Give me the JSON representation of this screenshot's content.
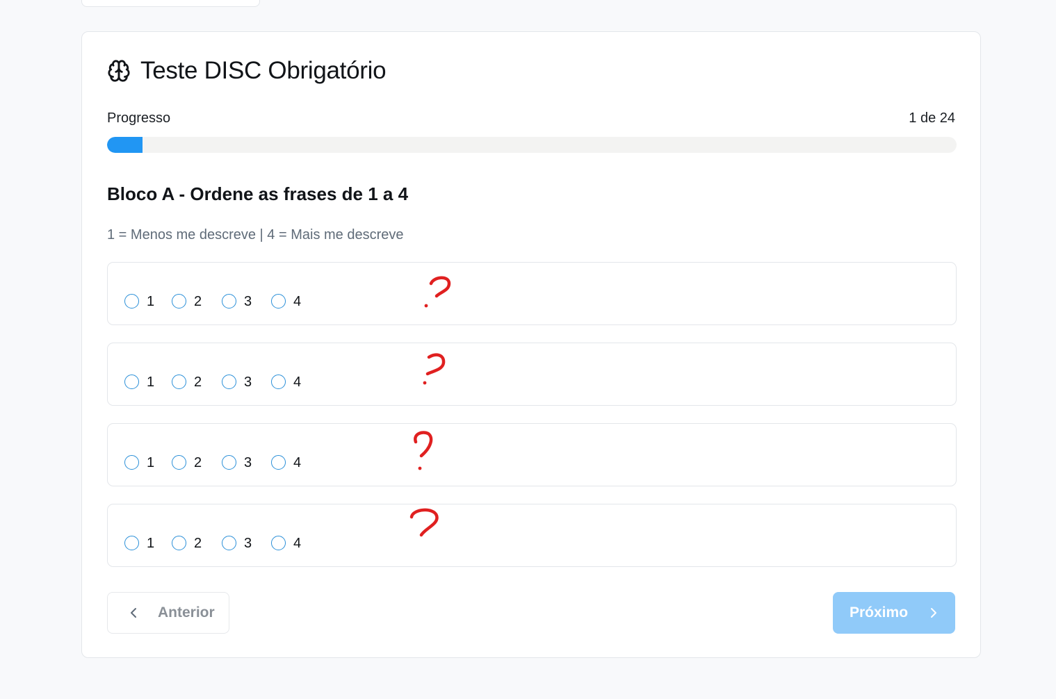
{
  "header": {
    "title": "Teste DISC Obrigatório",
    "icon": "brain-icon"
  },
  "progress": {
    "label": "Progresso",
    "count": "1 de 24",
    "fraction": 0.0417,
    "fill_color": "#2196f3"
  },
  "block": {
    "title": "Bloco A - Ordene as frases de 1 a 4",
    "scale_hint": "1 = Menos me descreve | 4 = Mais me descreve"
  },
  "statements": [
    {
      "text": "",
      "options": [
        "1",
        "2",
        "3",
        "4"
      ]
    },
    {
      "text": "",
      "options": [
        "1",
        "2",
        "3",
        "4"
      ]
    },
    {
      "text": "",
      "options": [
        "1",
        "2",
        "3",
        "4"
      ]
    },
    {
      "text": "",
      "options": [
        "1",
        "2",
        "3",
        "4"
      ]
    }
  ],
  "annotations": {
    "icon": "question-mark-icon",
    "color": "#e02020"
  },
  "navigation": {
    "prev_label": "Anterior",
    "next_label": "Próximo",
    "next_color": "#90caf9"
  }
}
